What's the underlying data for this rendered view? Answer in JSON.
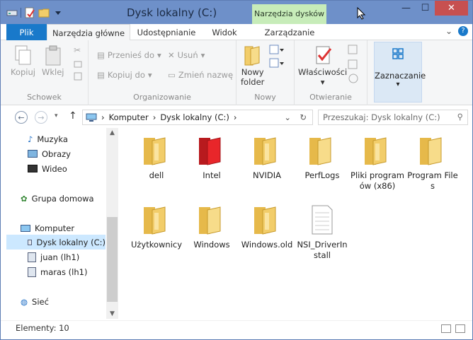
{
  "window": {
    "title": "Dysk lokalny (C:)",
    "context_tab": "Narzędzia dysków"
  },
  "tabs": [
    {
      "label": "Plik"
    },
    {
      "label": "Narzędzia główne"
    },
    {
      "label": "Udostępnianie"
    },
    {
      "label": "Widok"
    },
    {
      "label": "Zarządzanie"
    }
  ],
  "ribbon": {
    "schowek": {
      "label": "Schowek",
      "copy": "Kopiuj",
      "paste": "Wklej"
    },
    "organizowanie": {
      "label": "Organizowanie",
      "move": "Przenieś do",
      "copyto": "Kopiuj do",
      "delete": "Usuń",
      "rename": "Zmień nazwę"
    },
    "nowy": {
      "label": "Nowy",
      "new_folder_line1": "Nowy",
      "new_folder_line2": "folder"
    },
    "otwieranie": {
      "label": "Otwieranie",
      "properties": "Właściwości"
    },
    "select": {
      "label": "Zaznaczanie"
    }
  },
  "address": {
    "crumbs": [
      "Komputer",
      "Dysk lokalny (C:)"
    ],
    "search_placeholder": "Przeszukaj: Dysk lokalny (C:)"
  },
  "nav": {
    "items": [
      {
        "label": "Muzyka"
      },
      {
        "label": "Obrazy"
      },
      {
        "label": "Wideo"
      },
      {
        "label": "Grupa domowa"
      },
      {
        "label": "Komputer"
      },
      {
        "label": "Dysk lokalny (C:)"
      },
      {
        "label": "juan (lh1)"
      },
      {
        "label": "maras (lh1)"
      },
      {
        "label": "Sieć"
      }
    ]
  },
  "items": [
    {
      "label": "dell",
      "icon": "folder-icon"
    },
    {
      "label": "Intel",
      "icon": "folder-red-icon"
    },
    {
      "label": "NVIDIA",
      "icon": "folder-icon"
    },
    {
      "label": "PerfLogs",
      "icon": "folder-icon"
    },
    {
      "label": "Pliki programów (x86)",
      "icon": "folder-icon"
    },
    {
      "label": "Program Files",
      "icon": "folder-icon"
    },
    {
      "label": "Użytkownicy",
      "icon": "folder-icon"
    },
    {
      "label": "Windows",
      "icon": "folder-icon"
    },
    {
      "label": "Windows.old",
      "icon": "folder-icon"
    },
    {
      "label": "NSI_DriverInstall",
      "icon": "file-icon"
    }
  ],
  "status": {
    "count": "Elementy: 10"
  },
  "colors": {
    "titlebar": "#6e90c9",
    "file_tab": "#1979ca",
    "context": "#c7ecb9",
    "close": "#c75050",
    "folder": "#f2cd6a",
    "folder_red": "#e8262a"
  }
}
